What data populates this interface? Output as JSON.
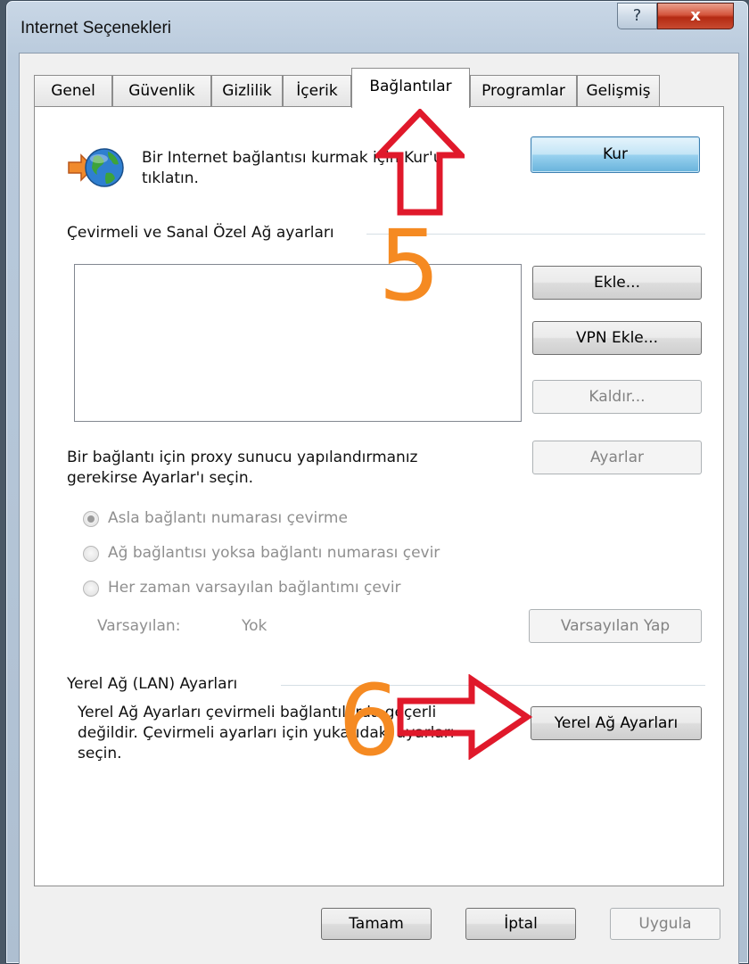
{
  "window": {
    "title": "Internet Seçenekleri",
    "help_glyph": "?",
    "close_glyph": "x"
  },
  "tabs": [
    {
      "label": "Genel",
      "active": false
    },
    {
      "label": "Güvenlik",
      "active": false
    },
    {
      "label": "Gizlilik",
      "active": false
    },
    {
      "label": "İçerik",
      "active": false
    },
    {
      "label": "Bağlantılar",
      "active": true
    },
    {
      "label": "Programlar",
      "active": false
    },
    {
      "label": "Gelişmiş",
      "active": false
    }
  ],
  "setup": {
    "icon": "network-globe-icon",
    "description_line1": "Bir Internet bağlantısı kurmak için Kur'u",
    "description_line2": "tıklatın.",
    "button": "Kur"
  },
  "dialup": {
    "group_label": "Çevirmeli ve Sanal Özel Ağ ayarları",
    "add_button": "Ekle...",
    "add_vpn_button": "VPN Ekle...",
    "remove_button": "Kaldır...",
    "settings_button": "Ayarlar",
    "proxy_text_line1": "Bir bağlantı için proxy sunucu yapılandırmanız",
    "proxy_text_line2": "gerekirse Ayarlar'ı seçin.",
    "radio_options": [
      {
        "label": "Asla bağlantı numarası çevirme",
        "checked": true
      },
      {
        "label": "Ağ bağlantısı yoksa bağlantı numarası çevir",
        "checked": false
      },
      {
        "label": "Her zaman varsayılan bağlantımı çevir",
        "checked": false
      }
    ],
    "default_label": "Varsayılan:",
    "default_value": "Yok",
    "set_default_button": "Varsayılan Yap"
  },
  "lan": {
    "group_label": "Yerel Ağ (LAN) Ayarları",
    "text_line1": "Yerel Ağ Ayarları çevirmeli bağlantılarda geçerli",
    "text_line2": "değildir. Çevirmeli ayarları için yukarıdaki ayarları",
    "text_line3": "seçin.",
    "button": "Yerel Ağ Ayarları"
  },
  "footer": {
    "ok_button": "Tamam",
    "cancel_button": "İptal",
    "apply_button": "Uygula"
  },
  "annotations": {
    "step5": "5",
    "step6": "6",
    "arrow_color": "#e0192b",
    "number_color": "#f58a22"
  }
}
